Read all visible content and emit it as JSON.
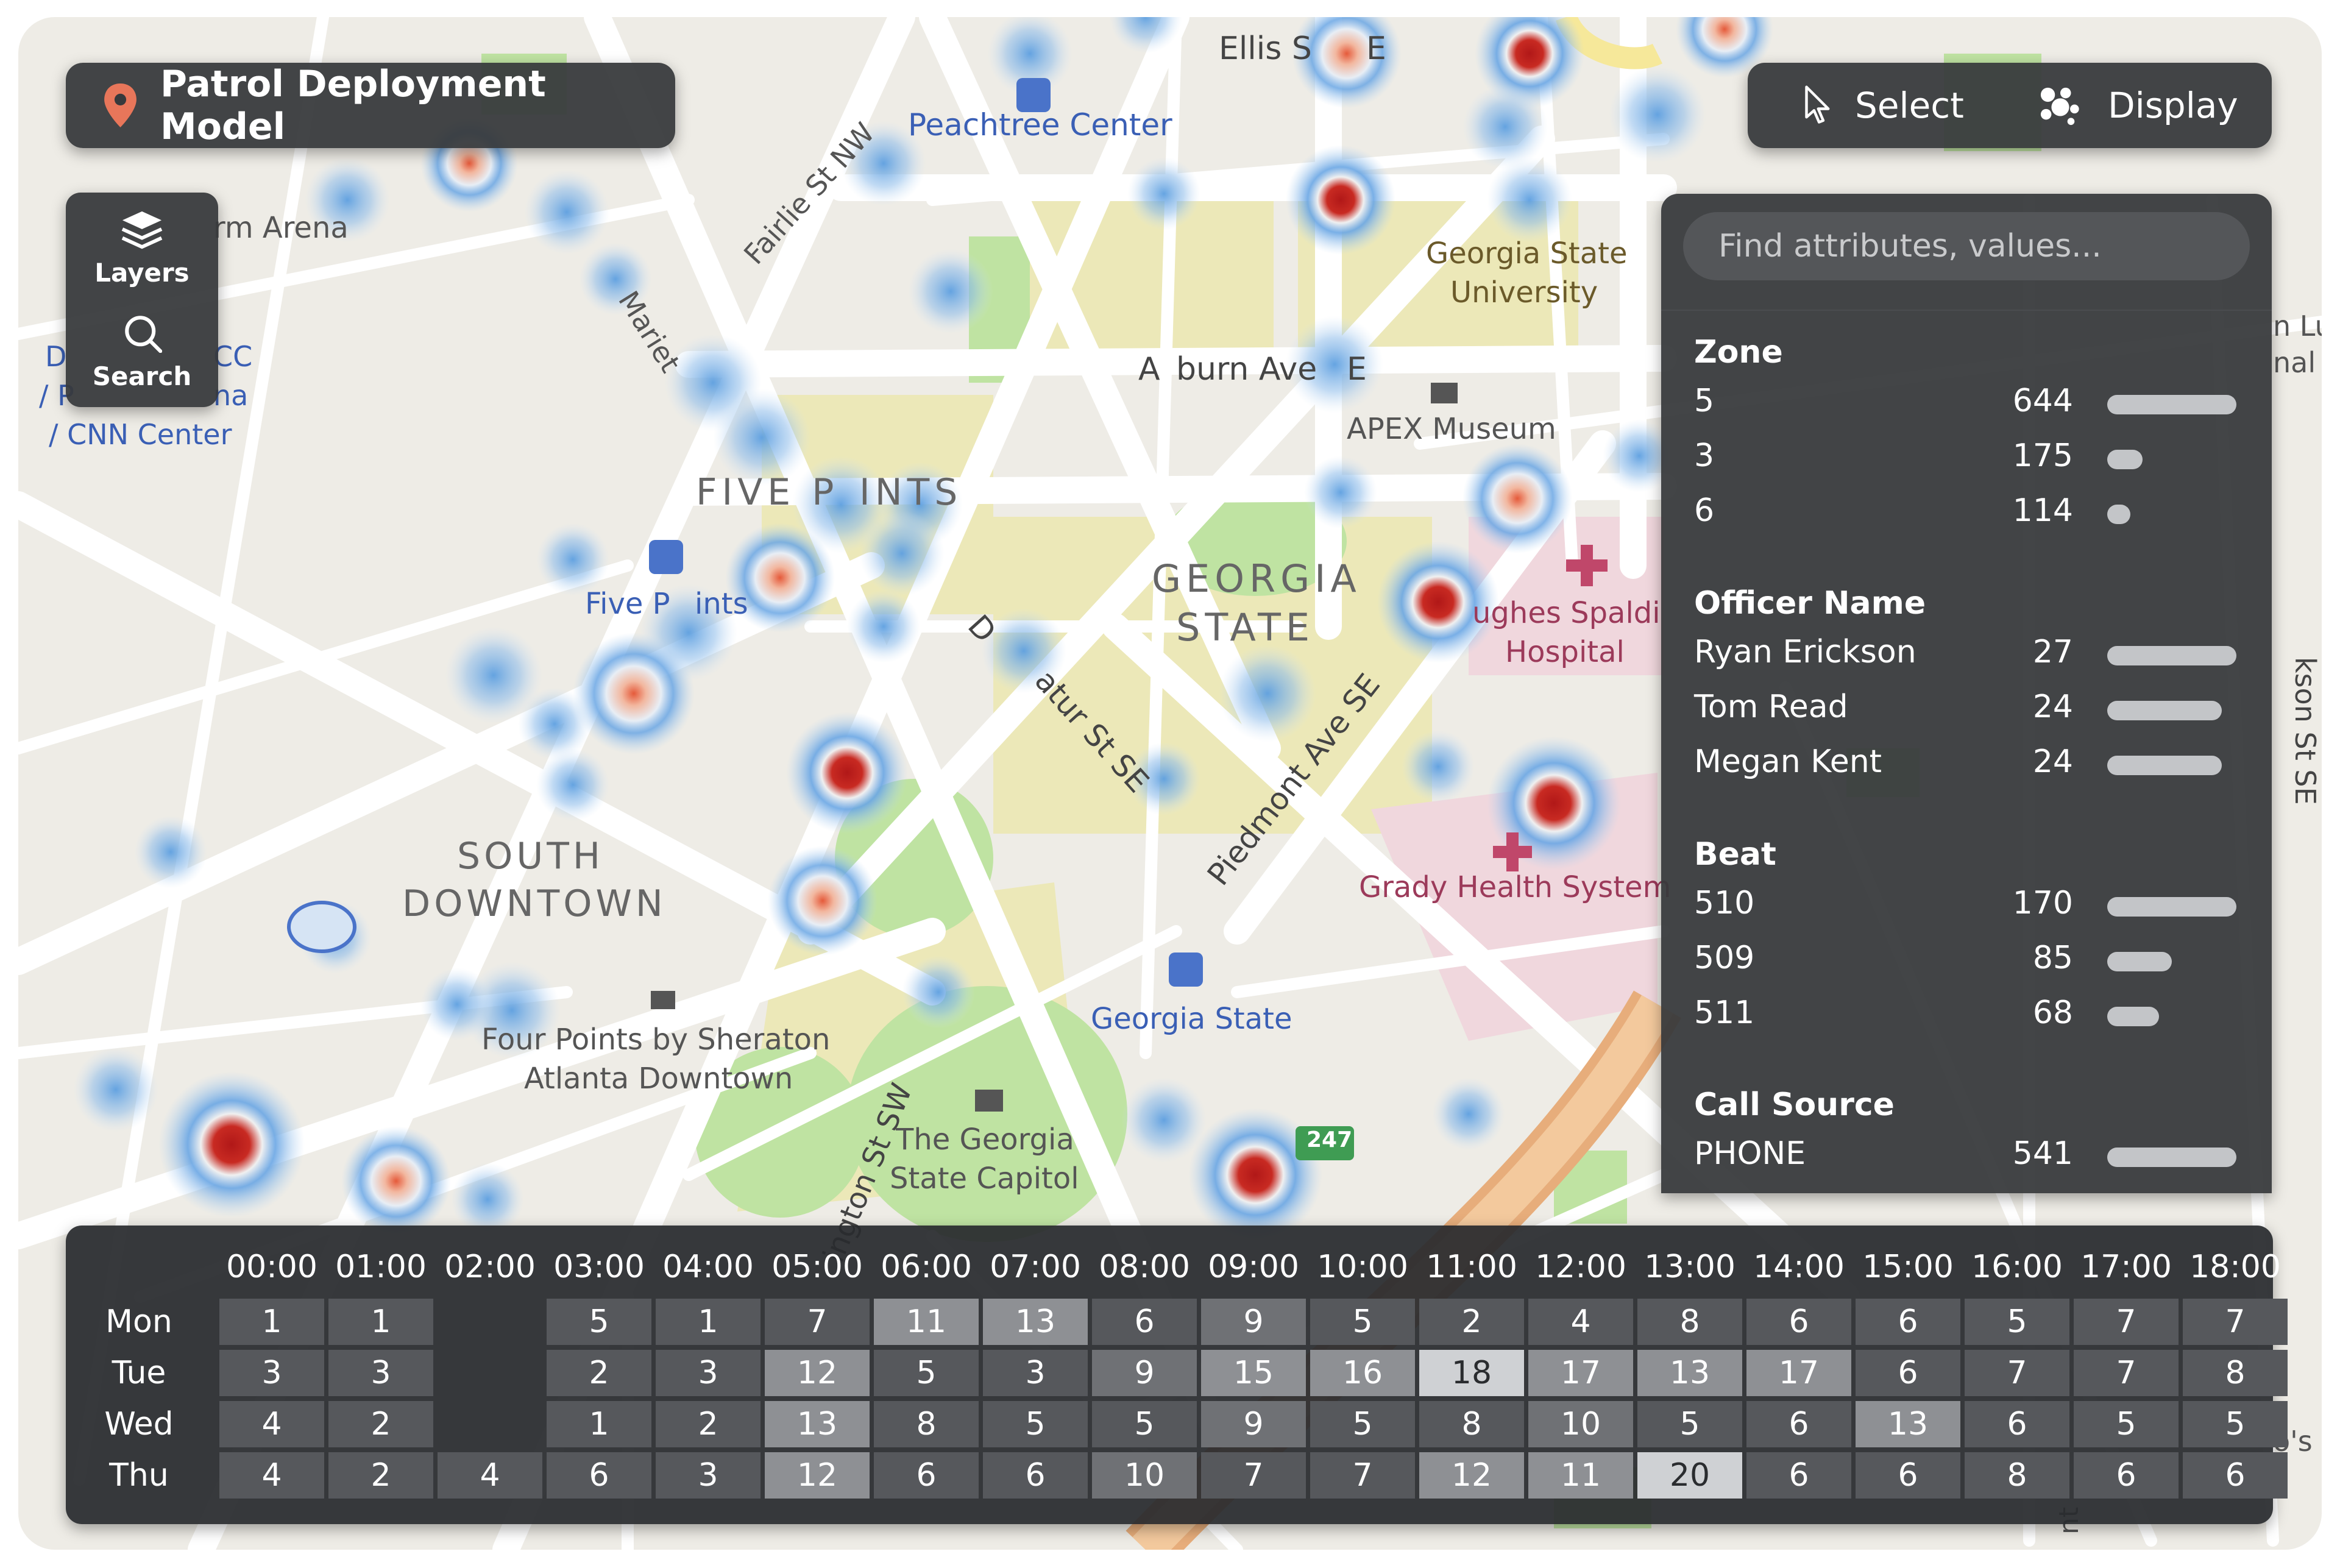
{
  "app": {
    "title": "Patrol Deployment Model",
    "accent_color": "#e8765a"
  },
  "sidebar": {
    "items": [
      {
        "label": "Layers",
        "icon": "layers-icon"
      },
      {
        "label": "Search",
        "icon": "search-icon"
      }
    ]
  },
  "toolbar": {
    "select_label": "Select",
    "display_label": "Display"
  },
  "panel": {
    "search_placeholder": "Find attributes, values...",
    "sections": [
      {
        "title": "Zone",
        "rows": [
          {
            "label": "5",
            "count": "644",
            "value": 644
          },
          {
            "label": "3",
            "count": "175",
            "value": 175
          },
          {
            "label": "6",
            "count": "114",
            "value": 114
          }
        ]
      },
      {
        "title": "Officer Name",
        "rows": [
          {
            "label": "Ryan Erickson",
            "count": "27",
            "value": 27
          },
          {
            "label": "Tom Read",
            "count": "24",
            "value": 24
          },
          {
            "label": "Megan Kent",
            "count": "24",
            "value": 24
          }
        ]
      },
      {
        "title": "Beat",
        "rows": [
          {
            "label": "510",
            "count": "170",
            "value": 170
          },
          {
            "label": "509",
            "count": "85",
            "value": 85
          },
          {
            "label": "511",
            "count": "68",
            "value": 68
          }
        ]
      },
      {
        "title": "Call Source",
        "rows": [
          {
            "label": "PHONE",
            "count": "541",
            "value": 541
          }
        ]
      }
    ]
  },
  "heatmap": {
    "hours": [
      "00:00",
      "01:00",
      "02:00",
      "03:00",
      "04:00",
      "05:00",
      "06:00",
      "07:00",
      "08:00",
      "09:00",
      "10:00",
      "11:00",
      "12:00",
      "13:00",
      "14:00",
      "15:00",
      "16:00",
      "17:00",
      "18:00"
    ],
    "days": [
      "Mon",
      "Tue",
      "Wed",
      "Thu"
    ],
    "values": [
      [
        1,
        1,
        null,
        5,
        1,
        7,
        11,
        13,
        6,
        9,
        5,
        2,
        4,
        8,
        6,
        6,
        5,
        7,
        7
      ],
      [
        3,
        3,
        null,
        2,
        3,
        12,
        5,
        3,
        9,
        15,
        16,
        18,
        17,
        13,
        17,
        6,
        7,
        7,
        8
      ],
      [
        4,
        2,
        null,
        1,
        2,
        13,
        8,
        5,
        5,
        9,
        5,
        8,
        10,
        5,
        6,
        13,
        6,
        5,
        5
      ],
      [
        4,
        2,
        4,
        6,
        3,
        12,
        6,
        6,
        10,
        7,
        7,
        12,
        11,
        20,
        6,
        6,
        8,
        6,
        6
      ]
    ]
  },
  "map": {
    "labels": [
      {
        "text": "Ellis S",
        "kind": "street"
      },
      {
        "text": "E",
        "kind": "street"
      },
      {
        "text": "Peachtree Center",
        "kind": "transit"
      },
      {
        "text": "rm Arena",
        "kind": "place"
      },
      {
        "text": "Fairlie St NW",
        "kind": "street"
      },
      {
        "text": "Mariet",
        "kind": "street"
      },
      {
        "text": "Georgia State",
        "kind": "place"
      },
      {
        "text": "University",
        "kind": "place"
      },
      {
        "text": "D",
        "kind": "place"
      },
      {
        "text": "CC",
        "kind": "transit"
      },
      {
        "text": "/ P",
        "kind": "transit"
      },
      {
        "text": "na",
        "kind": "transit"
      },
      {
        "text": "/ CNN Center",
        "kind": "transit"
      },
      {
        "text": "A",
        "kind": "street"
      },
      {
        "text": "burn Ave",
        "kind": "street"
      },
      {
        "text": "E",
        "kind": "street"
      },
      {
        "text": "APEX Museum",
        "kind": "place"
      },
      {
        "text": "FIVE P",
        "kind": "district"
      },
      {
        "text": "INTS",
        "kind": "district"
      },
      {
        "text": "Five P",
        "kind": "transit"
      },
      {
        "text": "ints",
        "kind": "transit"
      },
      {
        "text": "GEORGIA",
        "kind": "district"
      },
      {
        "text": "STATE",
        "kind": "district"
      },
      {
        "text": "ughes Spaldi",
        "kind": "hospital"
      },
      {
        "text": "Hospital",
        "kind": "hospital"
      },
      {
        "text": "D",
        "kind": "street"
      },
      {
        "text": "atur St SE",
        "kind": "street"
      },
      {
        "text": "Piedmont Ave SE",
        "kind": "street"
      },
      {
        "text": "SOUTH",
        "kind": "district"
      },
      {
        "text": "DOWNTOWN",
        "kind": "district"
      },
      {
        "text": "Grady Health System",
        "kind": "hospital"
      },
      {
        "text": "Four Points by Sheraton",
        "kind": "place"
      },
      {
        "text": "Atlanta Downtown",
        "kind": "place"
      },
      {
        "text": "Georgia State",
        "kind": "transit"
      },
      {
        "text": "ington St SW",
        "kind": "street"
      },
      {
        "text": "The Georgia",
        "kind": "place"
      },
      {
        "text": "State Capitol",
        "kind": "place"
      },
      {
        "text": "247",
        "kind": "shield"
      },
      {
        "text": "n Lu",
        "kind": "place"
      },
      {
        "text": "nal",
        "kind": "place"
      },
      {
        "text": "kson St SE",
        "kind": "street"
      },
      {
        "text": "o's",
        "kind": "place"
      },
      {
        "text": "nt",
        "kind": "street"
      }
    ]
  }
}
